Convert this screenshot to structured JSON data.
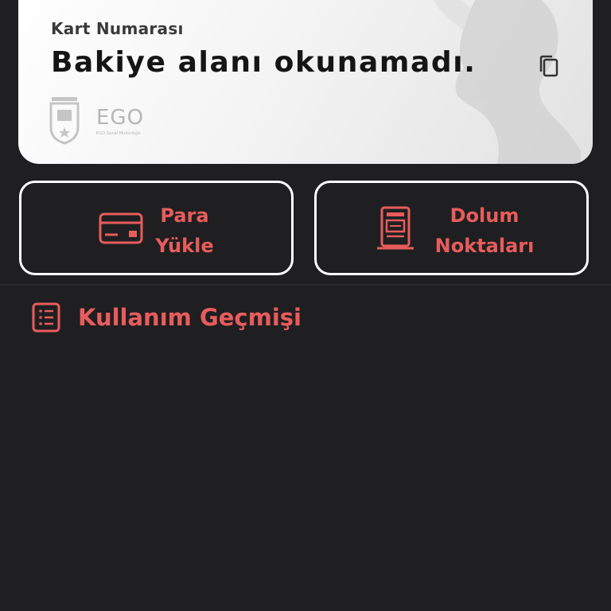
{
  "card": {
    "label": "Kart Numarası",
    "value": "Bakiye alanı okunamadı.",
    "logo_ego_text": "EGO",
    "logo_ego_sub": "EGO Genel Müdürlüğü"
  },
  "actions": [
    {
      "label_line1": "Para",
      "label_line2": "Yükle",
      "icon": "credit-card-icon"
    },
    {
      "label_line1": "Dolum",
      "label_line2": "Noktaları",
      "icon": "atm-kiosk-icon"
    }
  ],
  "history": {
    "label": "Kullanım Geçmişi",
    "icon": "list-icon"
  },
  "colors": {
    "background": "#1f1f21",
    "accent": "#e85c5c",
    "card": "#f2f2f2",
    "border": "#ffffff"
  }
}
